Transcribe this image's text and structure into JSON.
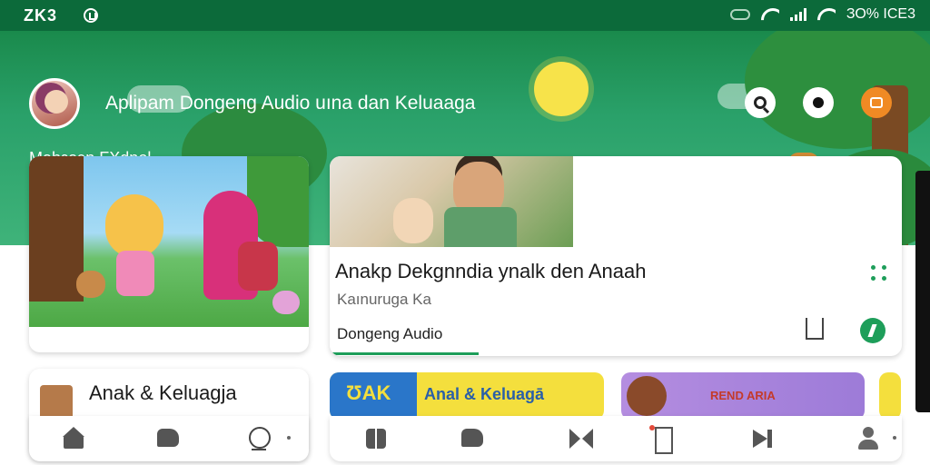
{
  "status_bar": {
    "brand": "ZK3",
    "battery_text": "ЗО% ICE3"
  },
  "header": {
    "app_title": "Aplipam Dongeng Audio uına dan Keluaaga",
    "user_name": "Mahɛaɔn FXdnol",
    "icons": [
      "avatar",
      "search-icon",
      "chat-icon",
      "notification-icon"
    ]
  },
  "cards": {
    "featured": {
      "title": "Anakp Dekgnndia ynalk den Anaah",
      "subtitle": "Kaınuruga Ka",
      "label": "Dongeng Audio",
      "progress": 0.26
    },
    "category": {
      "title": "Anak & Keluagja"
    },
    "banners": [
      {
        "tag": "ƱAK",
        "text": "Anal & Keluagā"
      },
      {
        "text": "REND ARIA"
      }
    ]
  },
  "bottom_nav_left": [
    "home-icon",
    "chat-icon",
    "profile-icon"
  ],
  "bottom_nav_right": [
    "book-icon",
    "chat-icon",
    "bowtie-icon",
    "door-icon",
    "next-icon",
    "person-icon"
  ],
  "colors": {
    "primary_green": "#1e9e5a",
    "status_bar": "#0c6a3a",
    "accent_orange": "#f08a24"
  }
}
